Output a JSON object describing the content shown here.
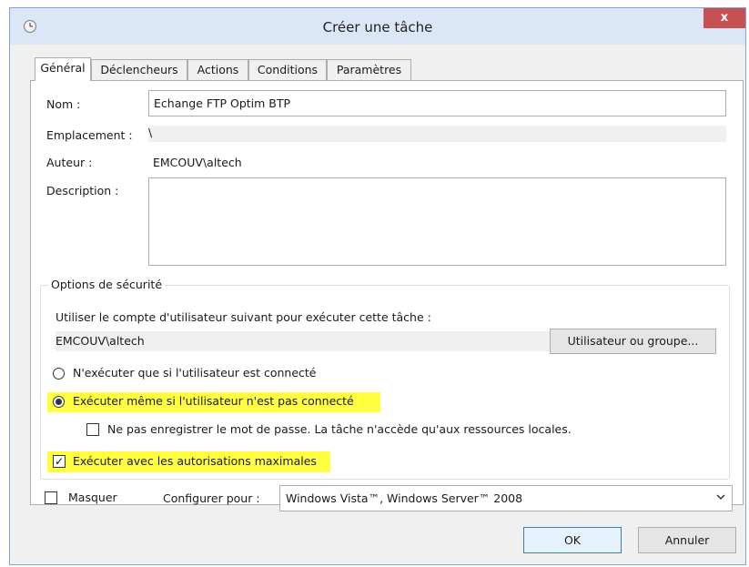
{
  "window": {
    "title": "Créer une tâche",
    "close_glyph": "x",
    "icon": "clock-icon",
    "accent_color": "#dbe7f6",
    "highlight_color": "#ffff40"
  },
  "tabs": [
    {
      "label": "Général",
      "active": true
    },
    {
      "label": "Déclencheurs",
      "active": false
    },
    {
      "label": "Actions",
      "active": false
    },
    {
      "label": "Conditions",
      "active": false
    },
    {
      "label": "Paramètres",
      "active": false
    }
  ],
  "general": {
    "name_label": "Nom :",
    "name_value": "Echange FTP Optim BTP",
    "location_label": "Emplacement :",
    "location_value": "\\",
    "author_label": "Auteur :",
    "author_value": "EMCOUV\\altech",
    "description_label": "Description :",
    "description_value": ""
  },
  "security": {
    "group_title": "Options de sécurité",
    "account_prompt": "Utiliser le compte d'utilisateur suivant pour exécuter cette tâche :",
    "account_value": "EMCOUV\\altech",
    "user_group_button": "Utilisateur ou groupe...",
    "radio_logged_on": {
      "label": "N'exécuter que si l'utilisateur est connecté",
      "selected": false
    },
    "radio_always": {
      "label": "Exécuter même si l'utilisateur n'est pas connecté",
      "selected": true
    },
    "no_store_password": {
      "label": "Ne pas enregistrer le mot de passe. La tâche n'accède qu'aux ressources locales.",
      "checked": false
    },
    "highest_privileges": {
      "label": "Exécuter avec les autorisations maximales",
      "checked": true
    }
  },
  "footer": {
    "hidden_label": "Masquer",
    "hidden_checked": false,
    "configure_label": "Configurer pour :",
    "configure_value": "Windows Vista™, Windows Server™ 2008",
    "ok_label": "OK",
    "cancel_label": "Annuler"
  }
}
